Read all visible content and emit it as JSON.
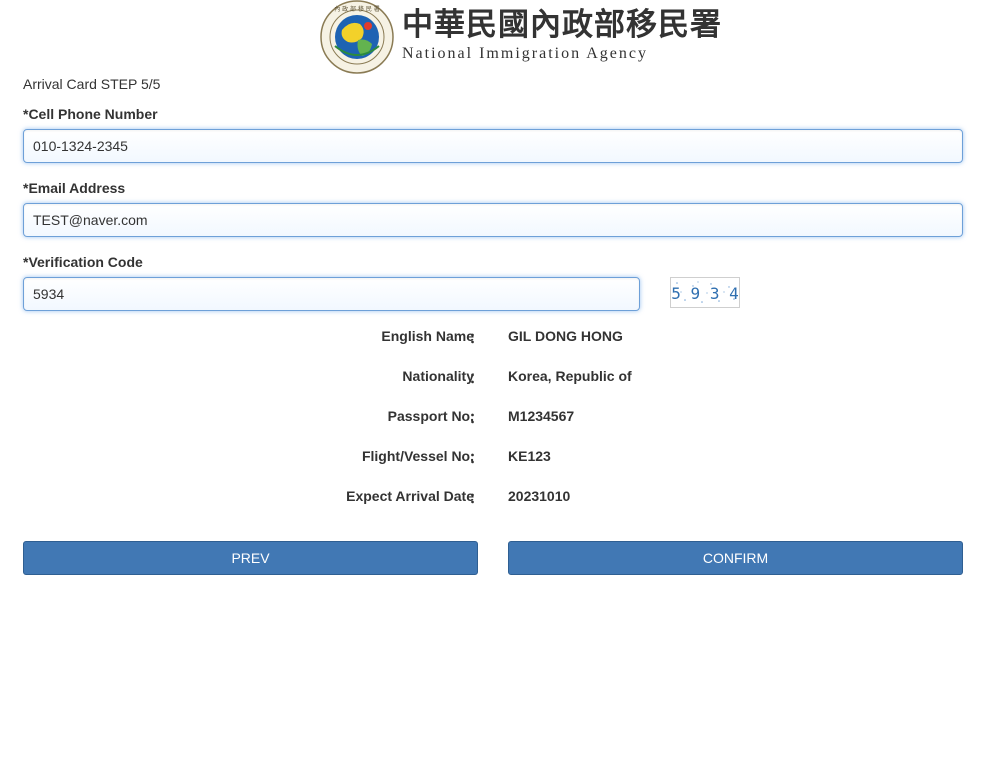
{
  "header": {
    "title_cn": "中華民國內政部移民署",
    "title_en": "National Immigration Agency",
    "logo_ring_text": "National Immigration Agency"
  },
  "step_text": "Arrival Card STEP 5/5",
  "form": {
    "phone_label": "*Cell Phone Number",
    "phone_value": "010-1324-2345",
    "email_label": "*Email Address",
    "email_value": "TEST@naver.com",
    "code_label": "*Verification Code",
    "code_value": "5934",
    "captcha_text": "5 9 3 4"
  },
  "summary": [
    {
      "label": "English Name",
      "value": "GIL DONG HONG"
    },
    {
      "label": "Nationality",
      "value": "Korea, Republic of"
    },
    {
      "label": "Passport No.",
      "value": "M1234567"
    },
    {
      "label": "Flight/Vessel No.",
      "value": "KE123"
    },
    {
      "label": "Expect Arrival Date",
      "value": "20231010"
    }
  ],
  "colon": "：",
  "buttons": {
    "prev": "PREV",
    "confirm": "CONFIRM"
  },
  "colors": {
    "button_bg": "#4178b4",
    "input_border": "#6ea0d8"
  }
}
